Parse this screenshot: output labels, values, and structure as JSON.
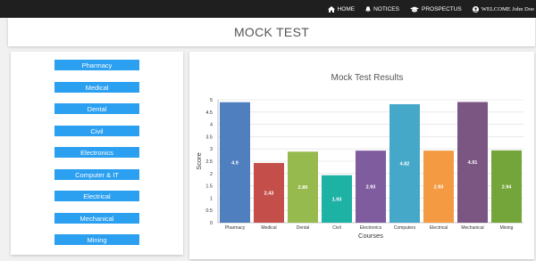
{
  "nav": {
    "home": "HOME",
    "notices": "NOTICES",
    "prospectus": "PROSPECTUS",
    "welcome": "WELCOME John Doe"
  },
  "page": {
    "title": "MOCK TEST"
  },
  "sidebar": {
    "items": [
      {
        "label": "Pharmacy"
      },
      {
        "label": "Medical"
      },
      {
        "label": "Dental"
      },
      {
        "label": "Civil"
      },
      {
        "label": "Electronics"
      },
      {
        "label": "Computer & IT"
      },
      {
        "label": "Electrical"
      },
      {
        "label": "Mechanical"
      },
      {
        "label": "Mining"
      }
    ],
    "button_color": "#2b9ff0"
  },
  "chart_data": {
    "type": "bar",
    "title": "Mock Test Results",
    "xlabel": "Courses",
    "ylabel": "Score",
    "ylim": [
      0,
      5
    ],
    "yticks": [
      "0",
      "0.5",
      "1",
      "1.5",
      "2",
      "2.5",
      "3",
      "3.5",
      "4",
      "4.5",
      "5"
    ],
    "grid": true,
    "categories": [
      "Pharmacy",
      "Medical",
      "Dental",
      "Civil",
      "Electronics",
      "Computers",
      "Electrical",
      "Mechanical",
      "Mining"
    ],
    "values": [
      4.9,
      2.43,
      2.89,
      1.93,
      2.93,
      4.82,
      2.93,
      4.91,
      2.94
    ],
    "value_labels": [
      "4.9",
      "2.43",
      "2.89",
      "1.93",
      "2.93",
      "4.82",
      "2.93",
      "4.91",
      "2.94"
    ],
    "colors": [
      "#4f7fbf",
      "#c44e4a",
      "#97ba4e",
      "#1eb2a4",
      "#7e5c9d",
      "#46a8c9",
      "#f39a43",
      "#7c5683",
      "#73a53b"
    ]
  }
}
